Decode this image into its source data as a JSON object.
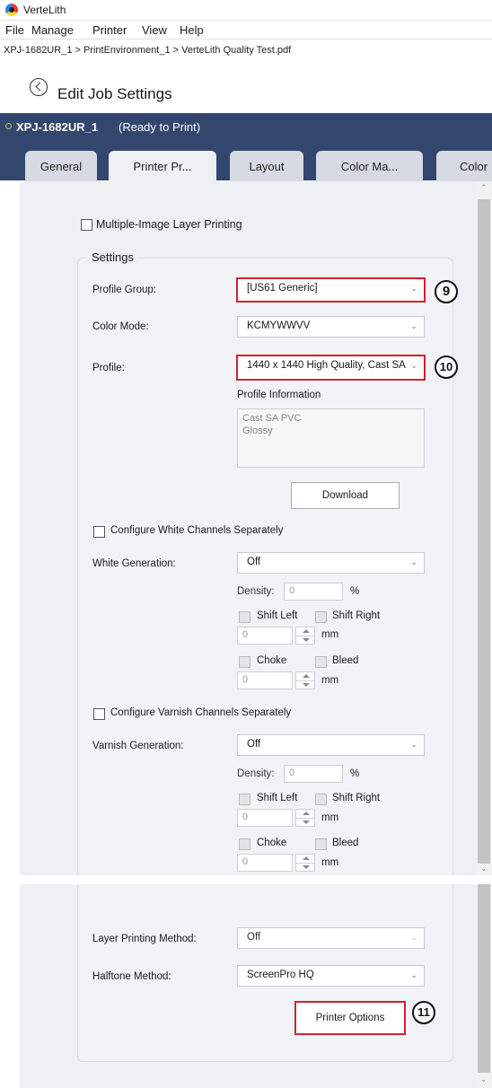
{
  "app": {
    "title": "VerteLith"
  },
  "menu": [
    "File",
    "Manage",
    "Printer",
    "View",
    "Help"
  ],
  "breadcrumb": "XPJ-1682UR_1 > PrintEnvironment_1 > VerteLith Quality Test.pdf",
  "page_title": "Edit Job Settings",
  "printer": {
    "name": "XPJ-1682UR_1",
    "status": "(Ready to Print)"
  },
  "tabs": [
    "General",
    "Printer Pr...",
    "Layout",
    "Color Ma...",
    "Color Ba"
  ],
  "multi_layer_label": "Multiple-Image Layer Printing",
  "settings": {
    "legend": "Settings",
    "profile_group_label": "Profile Group:",
    "profile_group_value": "[US61 Generic]",
    "color_mode_label": "Color Mode:",
    "color_mode_value": "KCMYWWVV",
    "profile_label": "Profile:",
    "profile_value": "1440 x 1440 High Quality, Cast SA",
    "profile_info_label": "Profile Information",
    "profile_info_line1": "Cast SA PVC",
    "profile_info_line2": "Glossy",
    "download": "Download",
    "white": {
      "configure_label": "Configure White Channels Separately",
      "generation_label": "White Generation:",
      "generation_value": "Off",
      "density_label": "Density:",
      "density_value": "0",
      "percent": "%",
      "shift_left": "Shift Left",
      "shift_right": "Shift Right",
      "shift_value": "0",
      "mm1": "mm",
      "choke": "Choke",
      "bleed": "Bleed",
      "choke_value": "0",
      "mm2": "mm"
    },
    "varnish": {
      "configure_label": "Configure Varnish Channels Separately",
      "generation_label": "Varnish Generation:",
      "generation_value": "Off",
      "density_label": "Density:",
      "density_value": "0",
      "percent": "%",
      "shift_left": "Shift Left",
      "shift_right": "Shift Right",
      "shift_value": "0",
      "mm1": "mm",
      "choke": "Choke",
      "bleed": "Bleed",
      "choke_value": "0",
      "mm2": "mm"
    },
    "layer_method_label": "Layer Printing Method:",
    "layer_method_value": "Off",
    "halftone_label": "Halftone Method:",
    "halftone_value": "ScreenPro HQ",
    "printer_options": "Printer Options"
  },
  "callouts": {
    "c9": "9",
    "c10": "10",
    "c11": "11"
  },
  "colors": {
    "header": "#33466e",
    "highlight": "#d32030",
    "panel": "#eef0f4"
  }
}
